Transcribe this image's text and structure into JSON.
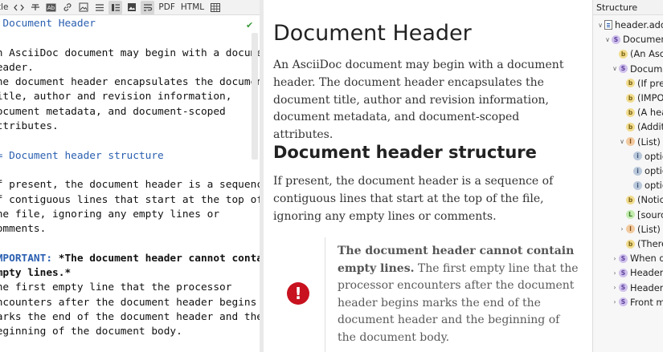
{
  "toolbar": {
    "title_fragment": "itle",
    "pdf_label": "PDF",
    "html_label": "HTML",
    "icons": [
      "code-icon",
      "strikethrough-icon",
      "ab-icon",
      "link-icon",
      "image-icon",
      "list-icon",
      "list-alt-icon",
      "picture-icon",
      "wrap-icon",
      "table-icon"
    ]
  },
  "editor": {
    "lines": [
      {
        "text": "= Document Header",
        "style": "heading"
      },
      {
        "text": "",
        "style": ""
      },
      {
        "text": "An AsciiDoc document may begin with a document",
        "style": ""
      },
      {
        "text": "header.",
        "style": ""
      },
      {
        "text": "The document header encapsulates the document",
        "style": ""
      },
      {
        "text": "title, author and revision information,",
        "style": ""
      },
      {
        "text": "document metadata, and document-scoped",
        "style": ""
      },
      {
        "text": "attributes.",
        "style": ""
      },
      {
        "text": "",
        "style": ""
      },
      {
        "text": "== Document header structure",
        "style": "heading"
      },
      {
        "text": "",
        "style": ""
      },
      {
        "text": "If present, the document header is a sequence",
        "style": ""
      },
      {
        "text": "of contiguous lines that start at the top of",
        "style": ""
      },
      {
        "text": "the file, ignoring any empty lines or",
        "style": ""
      },
      {
        "text": "comments.",
        "style": ""
      },
      {
        "text": "",
        "style": ""
      },
      {
        "text": "",
        "style": "important"
      },
      {
        "text": "empty lines.*",
        "style": "bold"
      },
      {
        "text": "The first empty line that the processor",
        "style": ""
      },
      {
        "text": "encounters after the document header begins",
        "style": ""
      },
      {
        "text": "marks the end of the document header and the",
        "style": ""
      },
      {
        "text": "beginning of the document body.",
        "style": ""
      }
    ],
    "important_prefix": "IMPORTANT: ",
    "important_bold": "*The document header cannot contain",
    "status": "✔"
  },
  "preview": {
    "h1": "Document Header",
    "p1": "An AsciiDoc document may begin with a document header. The document header encapsulates the document title, author and revision information, document metadata, and document-scoped attributes.",
    "h2": "Document header structure",
    "p2": "If present, the document header is a sequence of contiguous lines that start at the top of the file, ignoring any empty lines or comments.",
    "admonition_bold": "The document header cannot contain empty lines.",
    "admonition_text": " The first empty line that the processor encounters after the document header begins marks the end of the document header and the beginning of the document body.",
    "admonition_icon": "!"
  },
  "structure": {
    "title": "Structure",
    "items": [
      {
        "chevron": "v",
        "badge": "file",
        "label": "header.adoc",
        "indent": 0
      },
      {
        "chevron": "v",
        "badge": "S",
        "label": "Document Header",
        "indent": 1
      },
      {
        "chevron": "",
        "badge": "b",
        "label": "(An AsciiDoc document may begin",
        "indent": 2
      },
      {
        "chevron": "v",
        "badge": "S",
        "label": "Document header structure",
        "indent": 2
      },
      {
        "chevron": "",
        "badge": "b",
        "label": "(If present, the document",
        "indent": 3
      },
      {
        "chevron": "",
        "badge": "b",
        "label": "(IMPORTANT",
        "indent": 3
      },
      {
        "chevron": "",
        "badge": "b",
        "label": "(A header",
        "indent": 3
      },
      {
        "chevron": "",
        "badge": "b",
        "label": "(Additional",
        "indent": 3
      },
      {
        "chevron": "v",
        "badge": "l",
        "label": "(List)",
        "indent": 3
      },
      {
        "chevron": "",
        "badge": "i",
        "label": "optional",
        "indent": 4
      },
      {
        "chevron": "",
        "badge": "i",
        "label": "optional",
        "indent": 4
      },
      {
        "chevron": "",
        "badge": "i",
        "label": "optional",
        "indent": 4
      },
      {
        "chevron": "",
        "badge": "b",
        "label": "(Notice",
        "indent": 3
      },
      {
        "chevron": "",
        "badge": "L",
        "label": "[source",
        "indent": 3
      },
      {
        "chevron": ">",
        "badge": "l",
        "label": "(List)",
        "indent": 3
      },
      {
        "chevron": "",
        "badge": "b",
        "label": "(There are",
        "indent": 3
      },
      {
        "chevron": ">",
        "badge": "S",
        "label": "When does",
        "indent": 2
      },
      {
        "chevron": ">",
        "badge": "S",
        "label": "Header ref",
        "indent": 2
      },
      {
        "chevron": ">",
        "badge": "S",
        "label": "Header pro",
        "indent": 2
      },
      {
        "chevron": ">",
        "badge": "S",
        "label": "Front matter",
        "indent": 2
      }
    ]
  }
}
